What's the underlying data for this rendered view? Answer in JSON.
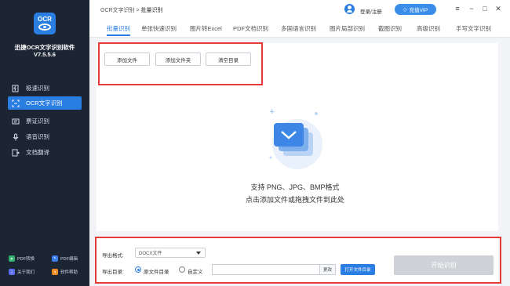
{
  "app": {
    "logo_text": "OCR",
    "name": "迅捷OCR文字识别软件",
    "version": "V7.5.5.6"
  },
  "sidebar": {
    "items": [
      {
        "label": "极速识别",
        "icon": "lightning-doc-icon"
      },
      {
        "label": "OCR文字识别",
        "icon": "scan-icon"
      },
      {
        "label": "票证识别",
        "icon": "ticket-icon"
      },
      {
        "label": "语音识别",
        "icon": "microphone-icon"
      },
      {
        "label": "文档翻译",
        "icon": "translate-icon"
      }
    ],
    "bottom_links": [
      {
        "label": "PDF转换",
        "icon": "pdf-convert-icon",
        "color": "#2fb06b"
      },
      {
        "label": "PDF编辑",
        "icon": "pdf-edit-icon",
        "color": "#3a7be8"
      },
      {
        "label": "关于我们",
        "icon": "about-icon",
        "color": "#5b6cf0"
      },
      {
        "label": "软件帮助",
        "icon": "help-icon",
        "color": "#f08a24"
      }
    ]
  },
  "header": {
    "breadcrumb_root": "OCR文字识别",
    "breadcrumb_sep": ">",
    "breadcrumb_current": "批量识别",
    "login_label": "登录/注册",
    "vip_label": "充值VIP"
  },
  "tabs": [
    "批量识别",
    "单张快速识别",
    "图片转Excel",
    "PDF文档识别",
    "多国语言识别",
    "图片局部识别",
    "截图识别",
    "高级识别",
    "手写文字识别"
  ],
  "toolbar": {
    "add_file": "添加文件",
    "add_folder": "添加文件夹",
    "clear": "清空目录"
  },
  "dropzone": {
    "formats_hint": "支持 PNG、JPG、BMP格式",
    "drop_hint": "点击添加文件或拖拽文件到此处"
  },
  "export": {
    "format_label": "导出格式:",
    "format_value": "DOCX文件",
    "dir_label": "导出目录:",
    "radio_source": "原文件目录",
    "radio_custom": "自定义",
    "path_value": "",
    "change_label": "更改",
    "open_label": "打开文件目录",
    "start_label": "开始识别"
  },
  "colors": {
    "accent": "#2a7de1",
    "sidebar_bg": "#1c2533",
    "highlight_box": "#e83a3a"
  }
}
